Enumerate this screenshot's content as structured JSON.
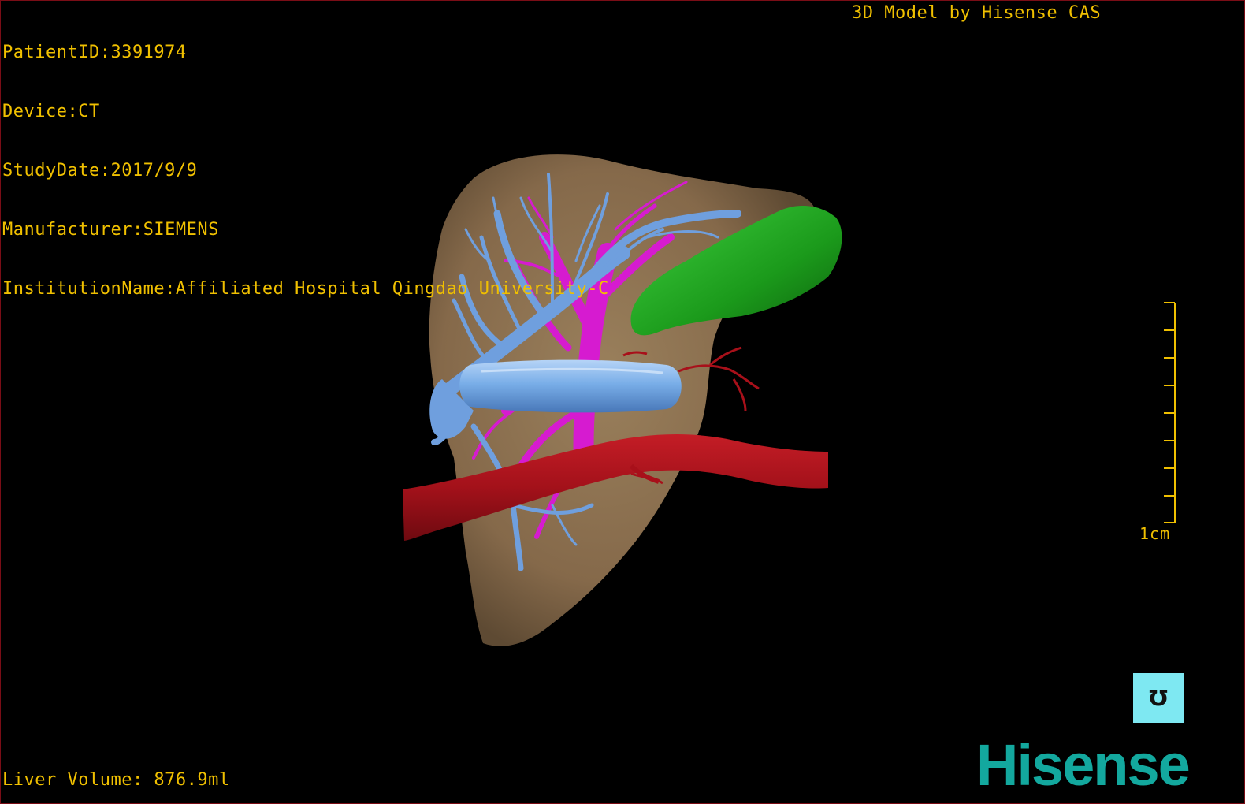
{
  "dicom_info": {
    "patient_id": "PatientID:3391974",
    "device": "Device:CT",
    "study_date": "StudyDate:2017/9/9",
    "manufacturer": "Manufacturer:SIEMENS",
    "institution": "InstitutionName:Affiliated Hospital Qingdao University-C"
  },
  "model_credit": "3D Model by Hisense CAS",
  "liver_volume": "Liver Volume: 876.9ml",
  "scale_label": "1cm",
  "orientation_label": "Ʊ",
  "brand": "Hisense",
  "colors": {
    "overlay_text": "#f0c000",
    "liver": "#8f7553",
    "portal_vein": "#6f9fde",
    "hepatic_vein": "#d61bd0",
    "artery": "#a8101a",
    "tumor": "#1ea01e",
    "orientation_cube": "#7ee8f2",
    "brand": "#13a89e"
  }
}
